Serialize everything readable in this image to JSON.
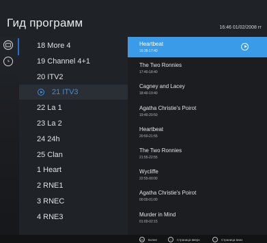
{
  "header": {
    "title": "Гид программ",
    "datetime": "16:46 01/02/2008 гг"
  },
  "rail": {
    "items": [
      {
        "icon": "tv-icon"
      },
      {
        "icon": "clock-icon"
      }
    ]
  },
  "channels": [
    {
      "label": "18 More 4"
    },
    {
      "label": "19 Channel 4+1"
    },
    {
      "label": "20 ITV2"
    },
    {
      "label": "21 ITV3",
      "selected": true
    },
    {
      "label": "22 La 1"
    },
    {
      "label": "23 La 2"
    },
    {
      "label": "24 24h"
    },
    {
      "label": "25 Clan"
    },
    {
      "label": "1 Heart"
    },
    {
      "label": "2 RNE1"
    },
    {
      "label": "3 RNEC"
    },
    {
      "label": "4 RNE3"
    }
  ],
  "programs": [
    {
      "title": "Heartbeat",
      "time": "16:35-17:40",
      "active": true
    },
    {
      "title": "The Two Ronnies",
      "time": "17:40-18:40"
    },
    {
      "title": "Cagney and Lacey",
      "time": "18:40-19:40"
    },
    {
      "title": "Agatha Christie's Poirot",
      "time": "19:40-20:50"
    },
    {
      "title": "Heartbeat",
      "time": "20:50-21:55"
    },
    {
      "title": "The Two Ronnies",
      "time": "21:55-22:55"
    },
    {
      "title": "Wycliffe",
      "time": "22:55-00:00"
    },
    {
      "title": "Agatha Christie's Poirot",
      "time": "00:00-01:00"
    },
    {
      "title": "Murder in Mind",
      "time": "01:00-02:15"
    }
  ],
  "footer": {
    "items": [
      {
        "key": "OK",
        "label": "Более"
      },
      {
        "key": "+",
        "label": "Страница вверх"
      },
      {
        "key": "−",
        "label": "Страница вниз"
      }
    ]
  },
  "colors": {
    "accent": "#3a9be8",
    "selected_channel_text": "#3a8fe0"
  }
}
